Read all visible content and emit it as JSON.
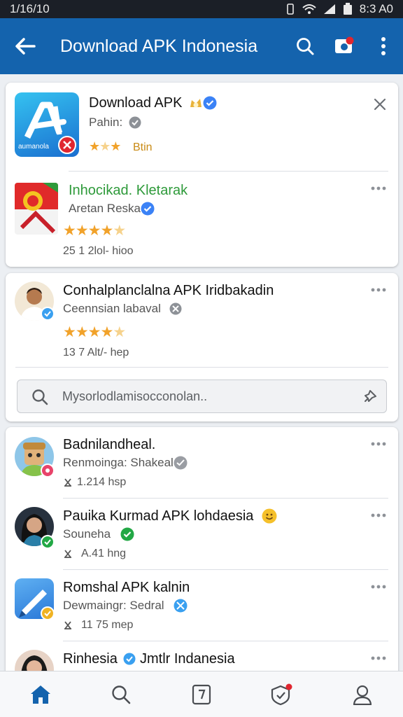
{
  "status_bar": {
    "time_left": "1/16/10",
    "time_right": "8:3 A0"
  },
  "app_bar": {
    "title": "Download APK Indonesia"
  },
  "card1": {
    "featured": {
      "name": "Download APK",
      "subtitle": "Pahin:",
      "rating_text": "Btin",
      "icon_caption": "aumanola",
      "rating": 3.0
    },
    "item": {
      "name": "Inhocikad. Kletarak",
      "publisher": "Aretan Reska",
      "rating": 4.5,
      "meta": "25 1 2lol- hioo"
    }
  },
  "card2": {
    "item": {
      "name": "Conhalplanclalna APK Iridbakadin",
      "publisher": "Ceennsian labaval",
      "rating": 4.0,
      "meta": "13 7 Alt/- hep"
    },
    "search": {
      "placeholder": "Mysorlodlamisocconolan.."
    }
  },
  "card3": {
    "items": [
      {
        "name": "Badnilandheal.",
        "sub": "Renmoinga: Shakeal",
        "meta": "1.214 hsp"
      },
      {
        "name": "Pauika Kurmad APK lohdaesia",
        "sub": "Souneha",
        "meta": "A.41 hng"
      },
      {
        "name": "Romshal APK kalnin",
        "sub": "Dewmaingr: Sedral",
        "meta": "11 75 mep"
      },
      {
        "name": "Rinhesia",
        "name2": "Jmtlr Indanesia"
      }
    ]
  },
  "colors": {
    "primary": "#1463ad",
    "star": "#f1a22a",
    "verified": "#3b82f6",
    "green_verified": "#22a845",
    "green_title": "#2e9a3a"
  },
  "icons": [
    "back-arrow-icon",
    "search-icon",
    "notification-icon",
    "more-vert-icon",
    "close-icon",
    "home-icon",
    "apps-icon",
    "shield-icon",
    "profile-icon"
  ]
}
